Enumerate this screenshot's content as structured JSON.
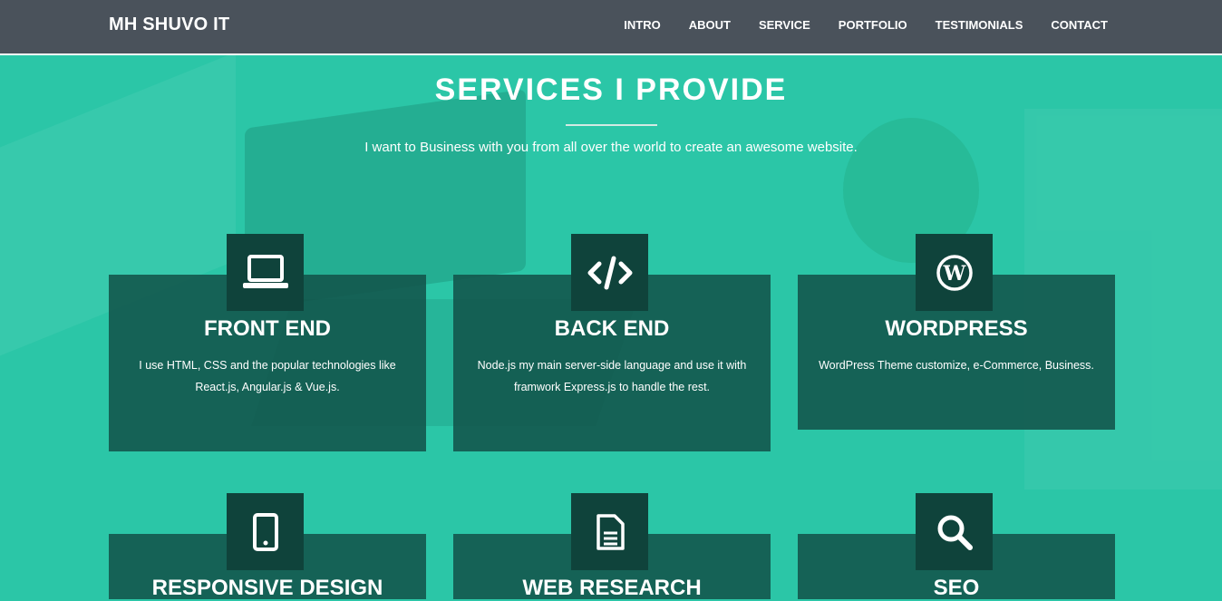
{
  "header": {
    "brand": "MH SHUVO IT",
    "nav": [
      "INTRO",
      "ABOUT",
      "SERVICE",
      "PORTFOLIO",
      "TESTIMONIALS",
      "CONTACT"
    ]
  },
  "section": {
    "title": "SERVICES I PROVIDE",
    "subtitle": "I want to Business with you from all over the world to create an awesome website."
  },
  "services": [
    {
      "icon": "laptop-icon",
      "title": "FRONT END",
      "description": "I use HTML, CSS and the popular technologies like React.js, Angular.js & Vue.js."
    },
    {
      "icon": "code-icon",
      "title": "BACK END",
      "description": "Node.js my main server-side language and use it with framwork Express.js to handle the rest."
    },
    {
      "icon": "wordpress-icon",
      "title": "WORDPRESS",
      "description": "WordPress Theme customize, e-Commerce, Business."
    },
    {
      "icon": "mobile-icon",
      "title": "RESPONSIVE DESIGN",
      "description": ""
    },
    {
      "icon": "file-text-icon",
      "title": "WEB RESEARCH",
      "description": ""
    },
    {
      "icon": "search-icon",
      "title": "SEO",
      "description": ""
    }
  ],
  "colors": {
    "navbar": "#4a525b",
    "background": "#2bc6a7",
    "card": "#125248",
    "icon_box": "#0f433b",
    "text": "#ffffff"
  }
}
